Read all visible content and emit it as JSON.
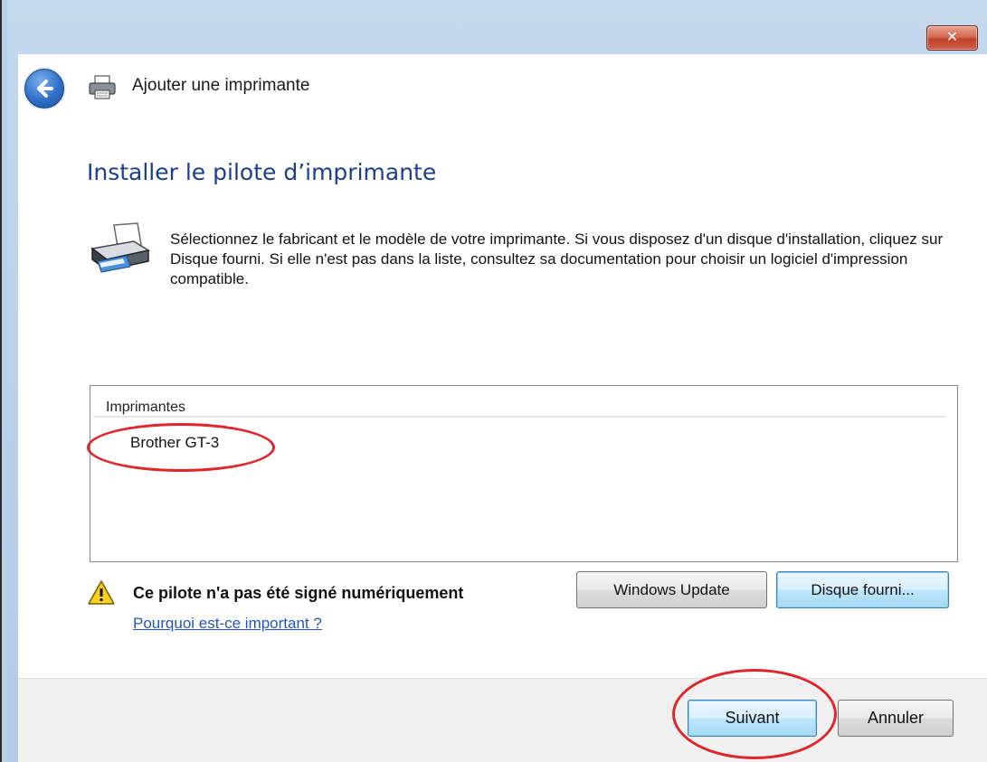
{
  "window": {
    "close_glyph": "✕",
    "header_title": "Ajouter une imprimante",
    "page_heading": "Installer le pilote d’imprimante",
    "description": "Sélectionnez le fabricant et le modèle de votre imprimante. Si vous disposez d'un disque d'installation, cliquez sur Disque fourni. Si elle n'est pas dans la liste, consultez sa documentation pour choisir un logiciel d'impression compatible."
  },
  "printer_list": {
    "header": "Imprimantes",
    "items": [
      "Brother GT-3"
    ]
  },
  "signature": {
    "warning": "Ce pilote n'a pas été signé numériquement",
    "link": "Pourquoi est-ce important ?",
    "windows_update_label": "Windows Update",
    "disk_label": "Disque fourni..."
  },
  "footer": {
    "next_label": "Suivant",
    "cancel_label": "Annuler"
  },
  "icons": {
    "back": "back-arrow-icon",
    "printer_small": "printer-icon",
    "printer_large": "printer-icon",
    "warning": "warning-icon",
    "close": "close-icon"
  },
  "colors": {
    "heading": "#1d3e8a",
    "link": "#2456b8",
    "annotation": "#e0252b",
    "close_button": "#c0402a"
  }
}
